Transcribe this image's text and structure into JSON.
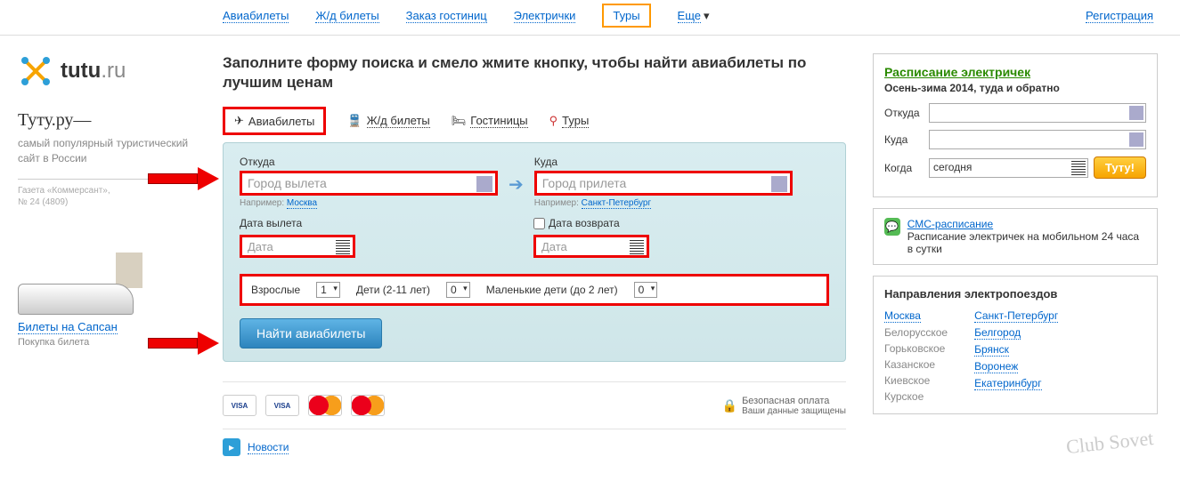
{
  "topnav": {
    "items": [
      "Авиабилеты",
      "Ж/д билеты",
      "Заказ гостиниц",
      "Электрички",
      "Туры"
    ],
    "more": "Еще",
    "register": "Регистрация",
    "active_index": 4
  },
  "logo": {
    "brand": "tutu",
    "tld": ".ru"
  },
  "tagline": {
    "head": "Туту.ру—",
    "sub": "самый популярный туристический сайт в России",
    "paper": "Газета «Коммерсант»,",
    "paper_no": "№ 24 (4809)"
  },
  "sapsan": {
    "link": "Билеты на Сапсан",
    "sub": "Покупка билета"
  },
  "heading": "Заполните форму поиска и смело жмите кнопку, чтобы найти авиабилеты по лучшим ценам",
  "tabs": {
    "avia": "Авиабилеты",
    "train": "Ж/д билеты",
    "hotel": "Гостиницы",
    "tours": "Туры"
  },
  "search": {
    "from_label": "Откуда",
    "from_placeholder": "Город вылета",
    "from_hint": "Например:",
    "from_example": "Москва",
    "to_label": "Куда",
    "to_placeholder": "Город прилета",
    "to_hint": "Например:",
    "to_example": "Санкт-Петербург",
    "dep_label": "Дата вылета",
    "ret_label": "Дата возврата",
    "date_placeholder": "Дата",
    "adults_label": "Взрослые",
    "adults_val": "1",
    "children_label": "Дети (2-11 лет)",
    "children_val": "0",
    "infants_label": "Маленькие дети (до 2 лет)",
    "infants_val": "0",
    "button": "Найти авиабилеты"
  },
  "payments": {
    "secure": "Безопасная оплата",
    "secure_sub": "Ваши данные защищены"
  },
  "news_label": "Новости",
  "sidebar": {
    "sched_title": "Расписание электричек",
    "sched_sub": "Осень-зима 2014, туда и обратно",
    "from": "Откуда",
    "to": "Куда",
    "when": "Когда",
    "when_val": "сегодня",
    "btn": "Туту!",
    "sms_title": "СМС-расписание",
    "sms_text": "Расписание электричек на мобильном 24 часа в сутки",
    "dir_head": "Направления электропоездов",
    "col1": [
      {
        "t": "Москва",
        "main": true
      },
      {
        "t": "Белорусское"
      },
      {
        "t": "Горьковское"
      },
      {
        "t": "Казанское"
      },
      {
        "t": "Киевское"
      },
      {
        "t": "Курское"
      }
    ],
    "col2": [
      {
        "t": "Санкт-Петербург",
        "main": true
      },
      {
        "t": "Белгород",
        "main": true
      },
      {
        "t": "Брянск",
        "main": true
      },
      {
        "t": "Воронеж",
        "main": true
      },
      {
        "t": "Екатеринбург",
        "main": true
      }
    ]
  },
  "watermark": "Club Sovet"
}
